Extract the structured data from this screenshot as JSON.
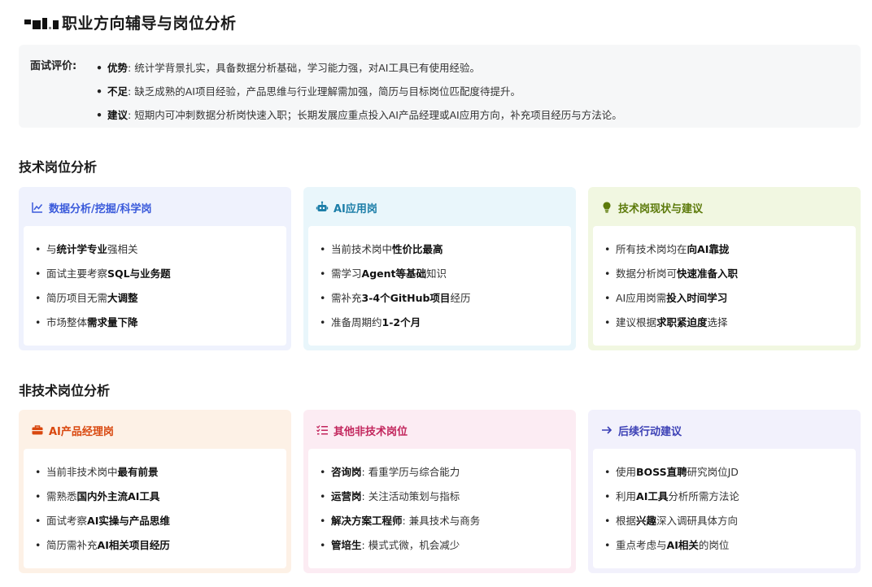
{
  "header": {
    "title": "职业方向辅导与岗位分析"
  },
  "evaluation": {
    "label": "面试评价:",
    "items": [
      {
        "key": "优势",
        "sep": ":",
        "text": "统计学背景扎实，具备数据分析基础，学习能力强，对AI工具已有使用经验。"
      },
      {
        "key": "不足",
        "sep": ":",
        "text": "缺乏成熟的AI项目经验，产品思维与行业理解需加强，简历与目标岗位匹配度待提升。"
      },
      {
        "key": "建议",
        "sep": ":",
        "text": "短期内可冲刺数据分析岗快速入职；长期发展应重点投入AI产品经理或AI应用方向，补充项目经历与方法论。"
      }
    ]
  },
  "sections": {
    "tech": "技术岗位分析",
    "nontech": "非技术岗位分析"
  },
  "cards": {
    "data_analysis": {
      "title": "数据分析/挖掘/科学岗",
      "icon": "line-chart-icon",
      "accent": "#3b5bdb",
      "items": [
        {
          "a": "与",
          "b": "统计学专业",
          "c": "强相关"
        },
        {
          "a": "面试主要考察",
          "b": "SQL与业务题",
          "c": ""
        },
        {
          "a": "简历项目无需",
          "b": "大调整",
          "c": ""
        },
        {
          "a": "市场整体",
          "b": "需求量下降",
          "c": ""
        }
      ]
    },
    "ai_app": {
      "title": "AI应用岗",
      "icon": "robot-icon",
      "accent": "#1c7ea8",
      "items": [
        {
          "a": "当前技术岗中",
          "b": "性价比最高",
          "c": ""
        },
        {
          "a": "需学习",
          "b": "Agent等基础",
          "c": "知识"
        },
        {
          "a": "需补充",
          "b": "3-4个GitHub项目",
          "c": "经历"
        },
        {
          "a": "准备周期约",
          "b": "1-2个月",
          "c": ""
        }
      ]
    },
    "tech_status": {
      "title": "技术岗现状与建议",
      "icon": "lightbulb-icon",
      "accent": "#5c7a0a",
      "items": [
        {
          "a": "所有技术岗均在",
          "b": "向AI靠拢",
          "c": ""
        },
        {
          "a": "数据分析岗可",
          "b": "快速准备入职",
          "c": ""
        },
        {
          "a": "AI应用岗需",
          "b": "投入时间学习",
          "c": ""
        },
        {
          "a": "建议根据",
          "b": "求职紧迫度",
          "c": "选择"
        }
      ]
    },
    "ai_pm": {
      "title": "AI产品经理岗",
      "icon": "briefcase-icon",
      "accent": "#d9480f",
      "items": [
        {
          "a": "当前非技术岗中",
          "b": "最有前景",
          "c": ""
        },
        {
          "a": "需熟悉",
          "b": "国内外主流AI工具",
          "c": ""
        },
        {
          "a": "面试考察",
          "b": "AI实操与产品思维",
          "c": ""
        },
        {
          "a": "简历需补充",
          "b": "AI相关项目经历",
          "c": ""
        }
      ]
    },
    "other_nontech": {
      "title": "其他非技术岗位",
      "icon": "list-icon",
      "accent": "#c2255c",
      "items": [
        {
          "a": "",
          "b": "咨询岗",
          "c": ": 看重学历与综合能力"
        },
        {
          "a": "",
          "b": "运营岗",
          "c": ": 关注活动策划与指标"
        },
        {
          "a": "",
          "b": "解决方案工程师",
          "c": ": 兼具技术与商务"
        },
        {
          "a": "",
          "b": "管培生",
          "c": ": 模式式微，机会减少"
        }
      ]
    },
    "next_steps": {
      "title": "后续行动建议",
      "icon": "arrow-right-icon",
      "accent": "#3b3fb5",
      "items": [
        {
          "a": "使用",
          "b": "BOSS直聘",
          "c": "研究岗位JD"
        },
        {
          "a": "利用",
          "b": "AI工具",
          "c": "分析所需方法论"
        },
        {
          "a": "根据",
          "b": "兴趣",
          "c": "深入调研具体方向"
        },
        {
          "a": "重点考虑与",
          "b": "AI相关",
          "c": "的岗位"
        }
      ]
    }
  }
}
